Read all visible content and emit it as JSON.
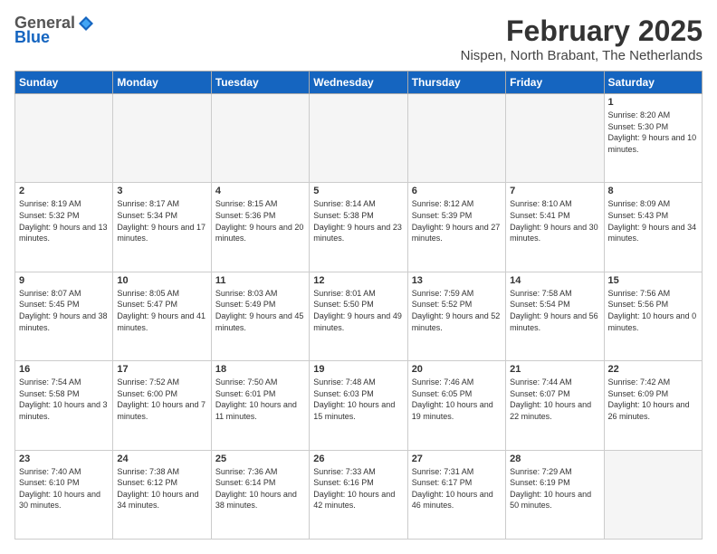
{
  "header": {
    "logo_general": "General",
    "logo_blue": "Blue",
    "month_year": "February 2025",
    "location": "Nispen, North Brabant, The Netherlands"
  },
  "weekdays": [
    "Sunday",
    "Monday",
    "Tuesday",
    "Wednesday",
    "Thursday",
    "Friday",
    "Saturday"
  ],
  "weeks": [
    [
      {
        "day": "",
        "info": ""
      },
      {
        "day": "",
        "info": ""
      },
      {
        "day": "",
        "info": ""
      },
      {
        "day": "",
        "info": ""
      },
      {
        "day": "",
        "info": ""
      },
      {
        "day": "",
        "info": ""
      },
      {
        "day": "1",
        "info": "Sunrise: 8:20 AM\nSunset: 5:30 PM\nDaylight: 9 hours and 10 minutes."
      }
    ],
    [
      {
        "day": "2",
        "info": "Sunrise: 8:19 AM\nSunset: 5:32 PM\nDaylight: 9 hours and 13 minutes."
      },
      {
        "day": "3",
        "info": "Sunrise: 8:17 AM\nSunset: 5:34 PM\nDaylight: 9 hours and 17 minutes."
      },
      {
        "day": "4",
        "info": "Sunrise: 8:15 AM\nSunset: 5:36 PM\nDaylight: 9 hours and 20 minutes."
      },
      {
        "day": "5",
        "info": "Sunrise: 8:14 AM\nSunset: 5:38 PM\nDaylight: 9 hours and 23 minutes."
      },
      {
        "day": "6",
        "info": "Sunrise: 8:12 AM\nSunset: 5:39 PM\nDaylight: 9 hours and 27 minutes."
      },
      {
        "day": "7",
        "info": "Sunrise: 8:10 AM\nSunset: 5:41 PM\nDaylight: 9 hours and 30 minutes."
      },
      {
        "day": "8",
        "info": "Sunrise: 8:09 AM\nSunset: 5:43 PM\nDaylight: 9 hours and 34 minutes."
      }
    ],
    [
      {
        "day": "9",
        "info": "Sunrise: 8:07 AM\nSunset: 5:45 PM\nDaylight: 9 hours and 38 minutes."
      },
      {
        "day": "10",
        "info": "Sunrise: 8:05 AM\nSunset: 5:47 PM\nDaylight: 9 hours and 41 minutes."
      },
      {
        "day": "11",
        "info": "Sunrise: 8:03 AM\nSunset: 5:49 PM\nDaylight: 9 hours and 45 minutes."
      },
      {
        "day": "12",
        "info": "Sunrise: 8:01 AM\nSunset: 5:50 PM\nDaylight: 9 hours and 49 minutes."
      },
      {
        "day": "13",
        "info": "Sunrise: 7:59 AM\nSunset: 5:52 PM\nDaylight: 9 hours and 52 minutes."
      },
      {
        "day": "14",
        "info": "Sunrise: 7:58 AM\nSunset: 5:54 PM\nDaylight: 9 hours and 56 minutes."
      },
      {
        "day": "15",
        "info": "Sunrise: 7:56 AM\nSunset: 5:56 PM\nDaylight: 10 hours and 0 minutes."
      }
    ],
    [
      {
        "day": "16",
        "info": "Sunrise: 7:54 AM\nSunset: 5:58 PM\nDaylight: 10 hours and 3 minutes."
      },
      {
        "day": "17",
        "info": "Sunrise: 7:52 AM\nSunset: 6:00 PM\nDaylight: 10 hours and 7 minutes."
      },
      {
        "day": "18",
        "info": "Sunrise: 7:50 AM\nSunset: 6:01 PM\nDaylight: 10 hours and 11 minutes."
      },
      {
        "day": "19",
        "info": "Sunrise: 7:48 AM\nSunset: 6:03 PM\nDaylight: 10 hours and 15 minutes."
      },
      {
        "day": "20",
        "info": "Sunrise: 7:46 AM\nSunset: 6:05 PM\nDaylight: 10 hours and 19 minutes."
      },
      {
        "day": "21",
        "info": "Sunrise: 7:44 AM\nSunset: 6:07 PM\nDaylight: 10 hours and 22 minutes."
      },
      {
        "day": "22",
        "info": "Sunrise: 7:42 AM\nSunset: 6:09 PM\nDaylight: 10 hours and 26 minutes."
      }
    ],
    [
      {
        "day": "23",
        "info": "Sunrise: 7:40 AM\nSunset: 6:10 PM\nDaylight: 10 hours and 30 minutes."
      },
      {
        "day": "24",
        "info": "Sunrise: 7:38 AM\nSunset: 6:12 PM\nDaylight: 10 hours and 34 minutes."
      },
      {
        "day": "25",
        "info": "Sunrise: 7:36 AM\nSunset: 6:14 PM\nDaylight: 10 hours and 38 minutes."
      },
      {
        "day": "26",
        "info": "Sunrise: 7:33 AM\nSunset: 6:16 PM\nDaylight: 10 hours and 42 minutes."
      },
      {
        "day": "27",
        "info": "Sunrise: 7:31 AM\nSunset: 6:17 PM\nDaylight: 10 hours and 46 minutes."
      },
      {
        "day": "28",
        "info": "Sunrise: 7:29 AM\nSunset: 6:19 PM\nDaylight: 10 hours and 50 minutes."
      },
      {
        "day": "",
        "info": ""
      }
    ]
  ]
}
